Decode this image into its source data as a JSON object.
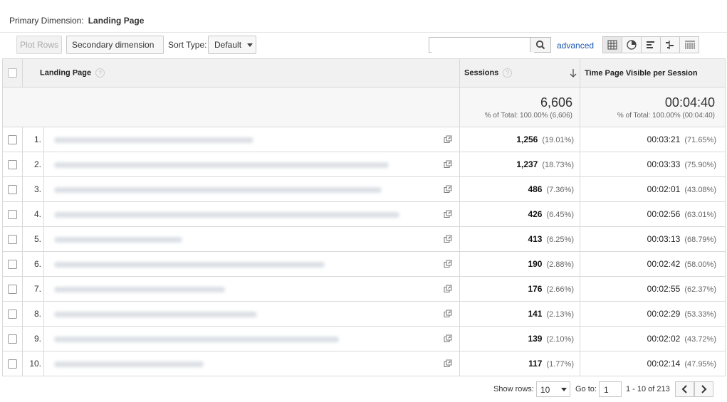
{
  "primary_dimension": {
    "label": "Primary Dimension:",
    "value": "Landing Page"
  },
  "toolbar": {
    "plot_rows": "Plot Rows",
    "secondary_dimension": "Secondary dimension",
    "sort_type_label": "Sort Type:",
    "sort_type_value": "Default",
    "search_placeholder": "",
    "advanced": "advanced",
    "view_icons": [
      "table-view-icon",
      "pie-view-icon",
      "performance-view-icon",
      "comparison-view-icon",
      "pivot-view-icon"
    ]
  },
  "table": {
    "columns": {
      "landing_page": "Landing Page",
      "sessions": "Sessions",
      "time_visible": "Time Page Visible per Session"
    },
    "totals": {
      "sessions": "6,606",
      "sessions_pct": "% of Total: 100.00% (6,606)",
      "time": "00:04:40",
      "time_pct": "% of Total: 100.00% (00:04:40)"
    },
    "rows": [
      {
        "n": "1.",
        "sessions": "1,256",
        "sessions_pct": "(19.01%)",
        "time": "00:03:21",
        "time_pct": "(71.65%)"
      },
      {
        "n": "2.",
        "sessions": "1,237",
        "sessions_pct": "(18.73%)",
        "time": "00:03:33",
        "time_pct": "(75.90%)"
      },
      {
        "n": "3.",
        "sessions": "486",
        "sessions_pct": "(7.36%)",
        "time": "00:02:01",
        "time_pct": "(43.08%)"
      },
      {
        "n": "4.",
        "sessions": "426",
        "sessions_pct": "(6.45%)",
        "time": "00:02:56",
        "time_pct": "(63.01%)"
      },
      {
        "n": "5.",
        "sessions": "413",
        "sessions_pct": "(6.25%)",
        "time": "00:03:13",
        "time_pct": "(68.79%)"
      },
      {
        "n": "6.",
        "sessions": "190",
        "sessions_pct": "(2.88%)",
        "time": "00:02:42",
        "time_pct": "(58.00%)"
      },
      {
        "n": "7.",
        "sessions": "176",
        "sessions_pct": "(2.66%)",
        "time": "00:02:55",
        "time_pct": "(62.37%)"
      },
      {
        "n": "8.",
        "sessions": "141",
        "sessions_pct": "(2.13%)",
        "time": "00:02:29",
        "time_pct": "(53.33%)"
      },
      {
        "n": "9.",
        "sessions": "139",
        "sessions_pct": "(2.10%)",
        "time": "00:02:02",
        "time_pct": "(43.72%)"
      },
      {
        "n": "10.",
        "sessions": "117",
        "sessions_pct": "(1.77%)",
        "time": "00:02:14",
        "time_pct": "(47.95%)"
      }
    ]
  },
  "footer": {
    "show_rows_label": "Show rows:",
    "show_rows_value": "10",
    "goto_label": "Go to:",
    "goto_value": "1",
    "range": "1 - 10 of 213"
  },
  "colors": {
    "link": "#1a58b0",
    "header_bg": "#f1f1f1",
    "border": "#d9d9d9"
  }
}
